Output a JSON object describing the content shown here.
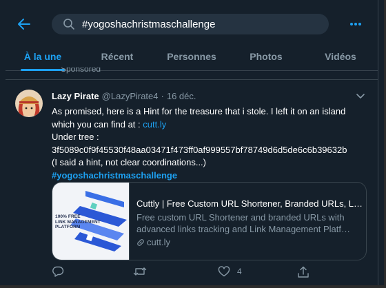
{
  "search": {
    "value": "#yogoshachristmaschallenge"
  },
  "icons": {
    "back": "arrow-left-icon",
    "search": "search-icon",
    "more": "more-horizontal-icon",
    "caret": "chevron-down-icon",
    "reply": "reply-icon",
    "retweet": "retweet-icon",
    "like": "heart-icon",
    "share": "share-icon",
    "link": "link-icon"
  },
  "tabs": [
    {
      "label": "À la une",
      "active": true
    },
    {
      "label": "Récent",
      "active": false
    },
    {
      "label": "Personnes",
      "active": false
    },
    {
      "label": "Photos",
      "active": false
    },
    {
      "label": "Vidéos",
      "active": false
    }
  ],
  "sponsored": {
    "label": "Sponsored"
  },
  "tweet": {
    "name": "Lazy Pirate",
    "handle": "@LazyPirate4",
    "separator": "·",
    "date": "16 déc.",
    "text_line1": "As promised, here is a Hint for the treasure that i stole. I left it on an island",
    "text_line2_before": "which you can find at : ",
    "text_line2_link": "cutt.ly",
    "text_line3": "Under tree :",
    "text_line4": "3f5089c0f9f45530f48aa03471f473ff0af999557bf78749d6d5de6c6b39632b",
    "text_line5": "(I said a hint, not clear coordinations...)",
    "hashtag": "#yogoshachristmaschallenge",
    "card": {
      "image_line1": "100% FREE",
      "image_line2": "LINK MANAGEMENT",
      "image_line3": "PLATFORM",
      "title": "Cuttly | Free Custom URL Shortener, Branded URLs, Link Management",
      "desc_line1": "Free custom URL Shortener and branded URLs with",
      "desc_line2": "advanced links tracking and Link Management Platform",
      "domain": "cutt.ly"
    },
    "actions": {
      "reply_count": "",
      "retweet_count": "",
      "like_count": "4"
    }
  },
  "colors": {
    "background": "#15202b",
    "accent": "#1da1f2",
    "muted": "#8899a6",
    "border": "#38444d",
    "search_bg": "#253341"
  }
}
